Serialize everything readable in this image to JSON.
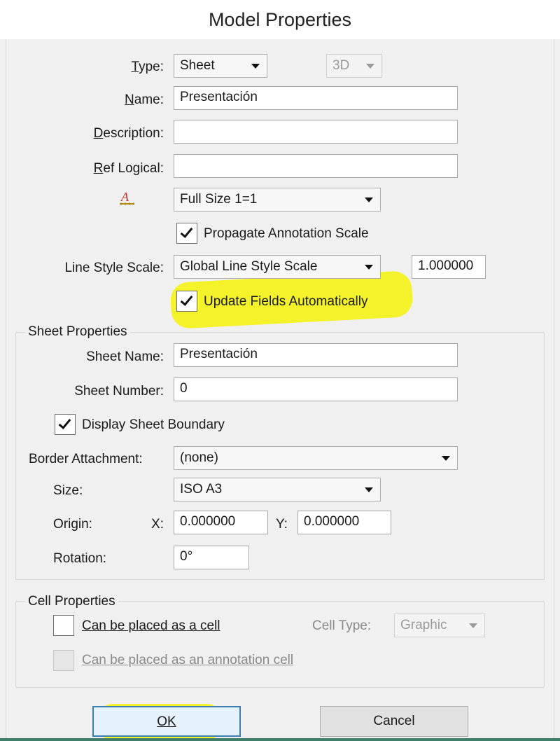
{
  "window": {
    "title": "Model Properties"
  },
  "model": {
    "type_label": "Type:",
    "type_value": "Sheet",
    "dimension_value": "3D",
    "name_label": "Name:",
    "name_value": "Presentación",
    "description_label": "Description:",
    "description_value": "",
    "ref_logical_label": "Ref Logical:",
    "ref_logical_value": "",
    "annotation_scale_value": "Full Size 1=1",
    "propagate_label": "Propagate Annotation Scale",
    "propagate_checked": true,
    "line_style_scale_label": "Line Style Scale:",
    "line_style_scale_value": "Global Line Style Scale",
    "line_style_scale_factor": "1.000000",
    "update_fields_label": "Update Fields Automatically",
    "update_fields_checked": true
  },
  "sheet": {
    "group_title": "Sheet Properties",
    "sheet_name_label": "Sheet Name:",
    "sheet_name_value": "Presentación",
    "sheet_number_label": "Sheet Number:",
    "sheet_number_value": "0",
    "display_boundary_label": "Display Sheet Boundary",
    "display_boundary_checked": true,
    "border_attachment_label": "Border Attachment:",
    "border_attachment_value": "(none)",
    "size_label": "Size:",
    "size_value": "ISO A3",
    "origin_label": "Origin:",
    "origin_x_label": "X:",
    "origin_x_value": "0.000000",
    "origin_y_label": "Y:",
    "origin_y_value": "0.000000",
    "rotation_label": "Rotation:",
    "rotation_value": "0°"
  },
  "cell": {
    "group_title": "Cell Properties",
    "placed_as_cell_label": "Can be placed as a cell",
    "placed_as_cell_checked": false,
    "cell_type_label": "Cell Type:",
    "cell_type_value": "Graphic",
    "annotation_cell_label": "Can be placed as an annotation cell",
    "annotation_cell_checked": false
  },
  "buttons": {
    "ok_label": "OK",
    "cancel_label": "Cancel"
  },
  "icons": {
    "annotation_scale_icon": "annotation-scale-icon"
  },
  "colors": {
    "highlight": "#f4f22a",
    "default_button_border": "#3c7fb1"
  }
}
